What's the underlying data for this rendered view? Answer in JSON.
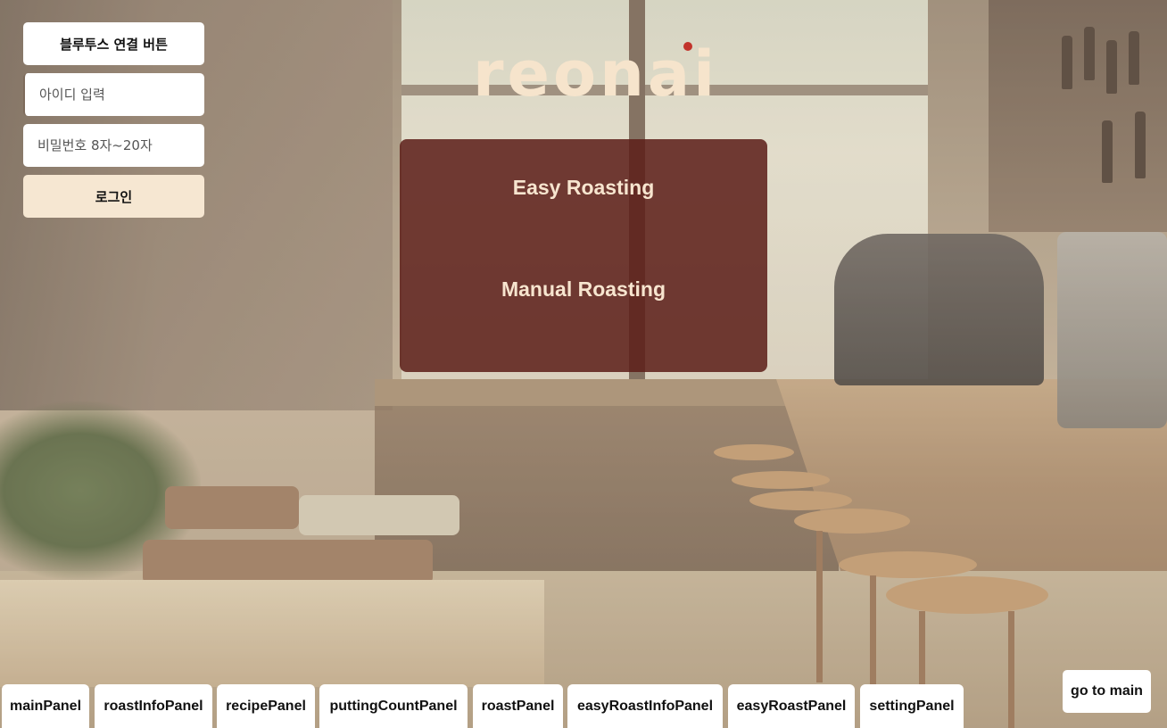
{
  "app": {
    "logo_text": "reonai",
    "accent_color": "#5c1e18",
    "cream_color": "#f6e7d2"
  },
  "login": {
    "bluetooth_button_label": "블루투스 연결 버튼",
    "id_placeholder": "아이디 입력",
    "password_placeholder": "비밀번호 8자~20자",
    "login_button_label": "로그인"
  },
  "menu": {
    "easy_roasting_label": "Easy Roasting",
    "manual_roasting_label": "Manual Roasting"
  },
  "panels": {
    "tabs": [
      {
        "label": "mainPanel"
      },
      {
        "label": "roastInfoPanel"
      },
      {
        "label": "recipePanel"
      },
      {
        "label": "puttingCountPanel"
      },
      {
        "label": "roastPanel"
      },
      {
        "label": "easyRoastInfoPanel"
      },
      {
        "label": "easyRoastPanel"
      },
      {
        "label": "settingPanel"
      }
    ],
    "go_to_main_label": "go to main"
  }
}
